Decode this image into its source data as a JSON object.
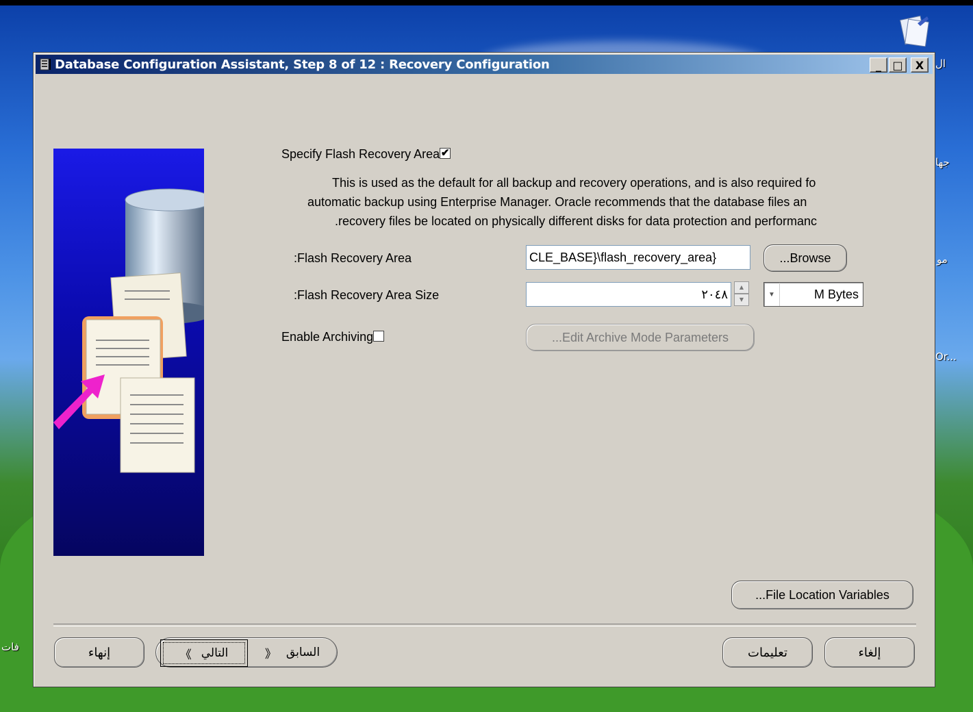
{
  "desktop": {
    "icon_labels": [
      "ال",
      "جها",
      "مو",
      "Or...",
      "فات"
    ]
  },
  "window": {
    "title": "Database Configuration Assistant, Step 8 of 12 : Recovery Configuration",
    "controls": {
      "minimize": "_",
      "maximize": "□",
      "close": "X"
    }
  },
  "form": {
    "specify_flash": {
      "label": "Specify Flash Recovery Area",
      "checked": true,
      "check_glyph": "✔"
    },
    "description": [
      "This is used as the default for all backup and recovery operations, and is also required fo",
      "automatic backup using Enterprise Manager. Oracle recommends that the database files an",
      ".recovery files be located on physically different disks for data protection and performanc"
    ],
    "flash_area": {
      "label": ":Flash Recovery Area",
      "value": "CLE_BASE}\\flash_recovery_area}",
      "browse": "...Browse"
    },
    "flash_size": {
      "label": ":Flash Recovery Area Size",
      "value": "٢٠٤٨",
      "unit": "M Bytes"
    },
    "archiving": {
      "label": "Enable Archiving",
      "checked": false,
      "edit_button": "...Edit Archive Mode Parameters"
    },
    "file_location_button": "...File Location Variables"
  },
  "buttons": {
    "finish": "إنهاء",
    "next": "التالي",
    "back": "السابق",
    "help": "تعليمات",
    "cancel": "إلغاء"
  }
}
